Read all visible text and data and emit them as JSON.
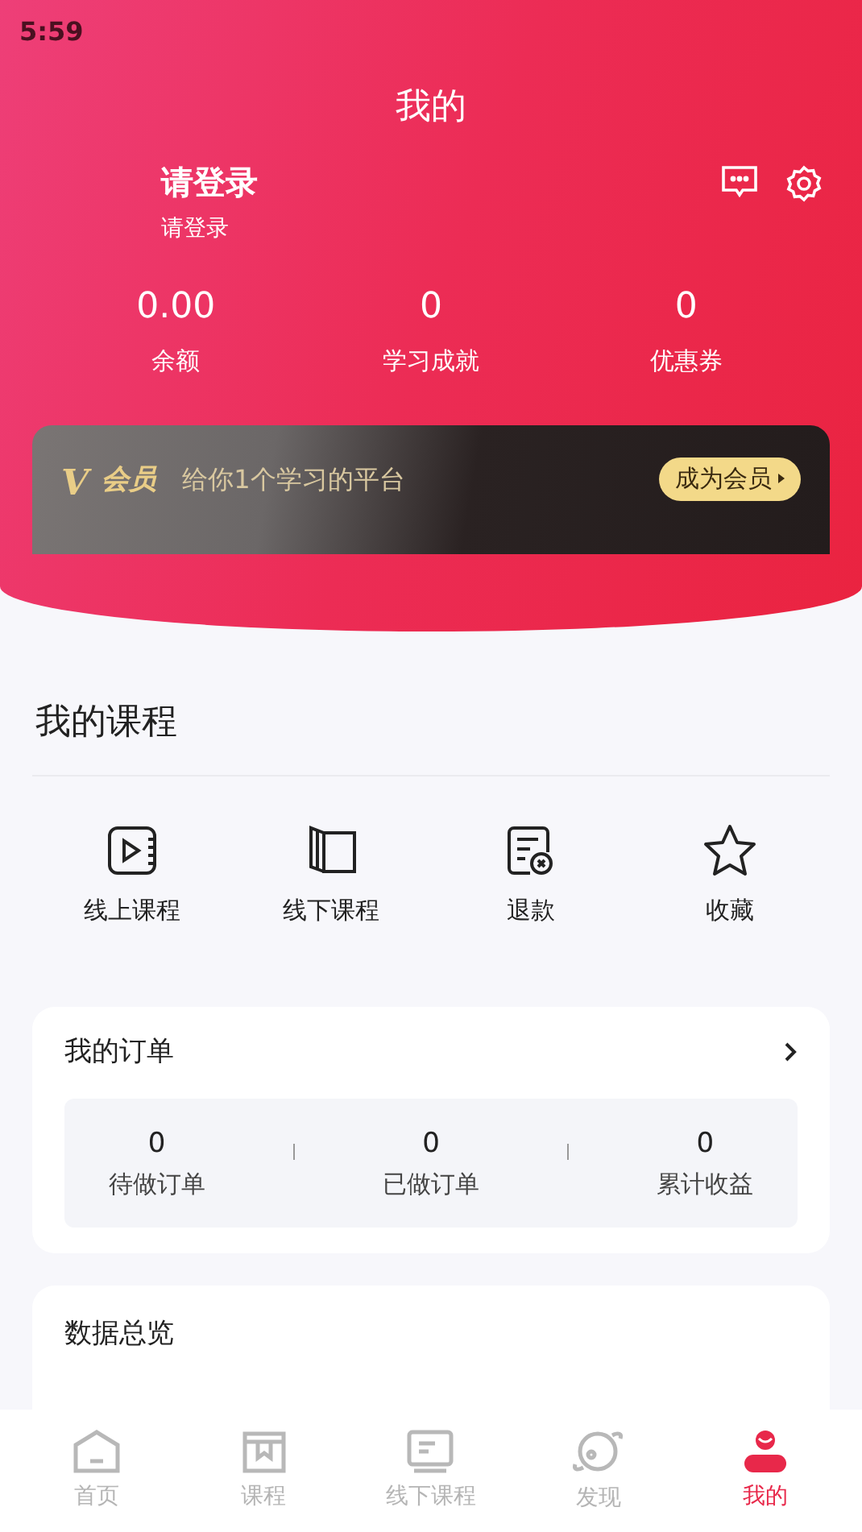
{
  "status_bar": {
    "time": "5:59"
  },
  "header": {
    "title": "我的"
  },
  "profile": {
    "name": "请登录",
    "subtitle": "请登录"
  },
  "stats": [
    {
      "value": "0.00",
      "label": "余额"
    },
    {
      "value": "0",
      "label": "学习成就"
    },
    {
      "value": "0",
      "label": "优惠券"
    }
  ],
  "vip_banner": {
    "badge": "V",
    "title": "会员",
    "slogan": "给你1个学习的平台",
    "button": "成为会员"
  },
  "my_courses": {
    "title": "我的课程",
    "items": [
      {
        "kind": "video",
        "label": "线上课程"
      },
      {
        "kind": "book",
        "label": "线下课程"
      },
      {
        "kind": "refund",
        "label": "退款"
      },
      {
        "kind": "star",
        "label": "收藏"
      }
    ]
  },
  "orders": {
    "title": "我的订单",
    "stats": [
      {
        "value": "0",
        "label": "待做订单"
      },
      {
        "value": "0",
        "label": "已做订单"
      },
      {
        "value": "0",
        "label": "累计收益"
      }
    ]
  },
  "data_overview": {
    "title": "数据总览"
  },
  "tab_bar": [
    {
      "kind": "home",
      "label": "首页",
      "selected": false
    },
    {
      "kind": "course",
      "label": "课程",
      "selected": false
    },
    {
      "kind": "offline",
      "label": "线下课程",
      "selected": false
    },
    {
      "kind": "discover",
      "label": "发现",
      "selected": false
    },
    {
      "kind": "me",
      "label": "我的",
      "selected": true
    }
  ]
}
